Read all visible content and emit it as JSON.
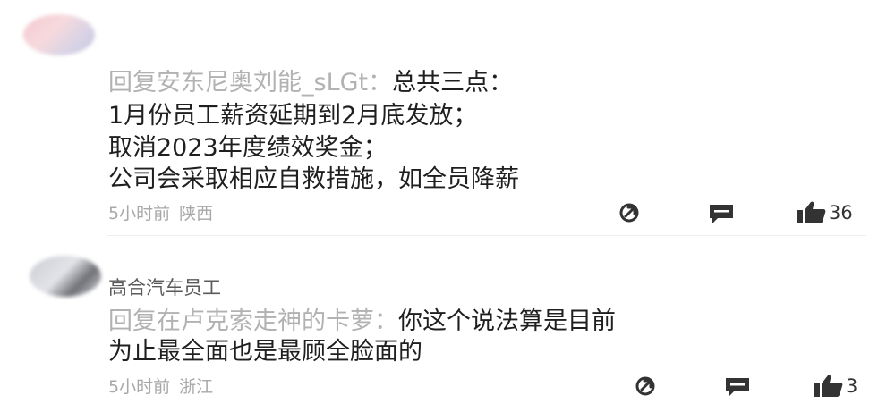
{
  "comments": [
    {
      "username": "",
      "user_tag": "",
      "reply_prefix": "回复安东尼奥刘能_sLGt：",
      "lines": [
        "总共三点：",
        "1月份员工薪资延期到2月底发放；",
        "取消2023年度绩效奖金；",
        "公司会采取相应自救措施，如全员降薪"
      ],
      "time": "5小时前",
      "location": "陕西",
      "likes": "36",
      "icons": [
        "share-icon",
        "reply-icon",
        "thumbs-up-icon"
      ]
    },
    {
      "username": "",
      "user_tag": "高合汽车员工",
      "reply_prefix": "回复在卢克索走神的卡萝：",
      "lines": [
        "你这个说法算是目前",
        "为止最全面也是最顾全脸面的"
      ],
      "time": "5小时前",
      "location": "浙江",
      "likes": "3",
      "icons": [
        "share-icon",
        "reply-icon",
        "thumbs-up-icon"
      ]
    }
  ]
}
